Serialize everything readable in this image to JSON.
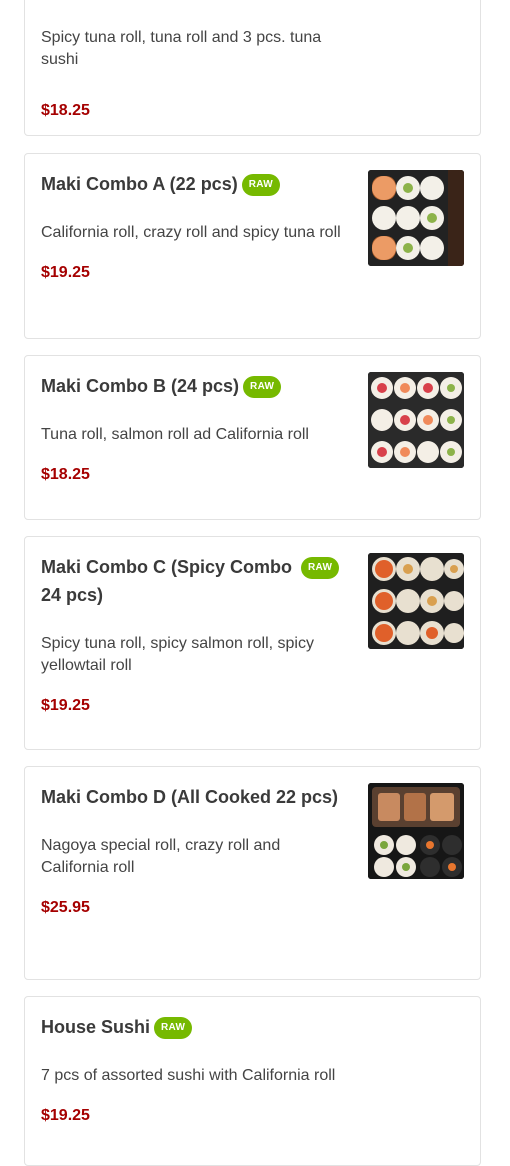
{
  "menu": {
    "items": [
      {
        "name": "",
        "raw": false,
        "description": "Spicy tuna roll, tuna roll and 3 pcs. tuna sushi",
        "price": "$18.25",
        "photo": "tuna-sushi-photo"
      },
      {
        "name": "Maki Combo A (22 pcs)",
        "raw": true,
        "raw_label": "RAW",
        "description": "California roll, crazy roll and spicy tuna roll",
        "price": "$19.25",
        "photo": "maki-combo-a-photo"
      },
      {
        "name": "Maki Combo B (24 pcs)",
        "raw": true,
        "raw_label": "RAW",
        "description": "Tuna roll, salmon roll ad California roll",
        "price": "$18.25",
        "photo": "maki-combo-b-photo"
      },
      {
        "name": "Maki Combo C (Spicy Combo 24 pcs)",
        "raw": true,
        "raw_label": "RAW",
        "description": "Spicy tuna roll, spicy salmon roll, spicy yellowtail roll",
        "price": "$19.25",
        "photo": "maki-combo-c-photo"
      },
      {
        "name": "Maki Combo D (All Cooked 22 pcs)",
        "raw": false,
        "description": "Nagoya special roll, crazy roll and California roll",
        "price": "$25.95",
        "photo": "maki-combo-d-photo"
      },
      {
        "name": "House Sushi",
        "raw": true,
        "raw_label": "RAW",
        "description": "7 pcs of assorted sushi with California roll",
        "price": "$19.25",
        "photo": null
      }
    ]
  },
  "colors": {
    "price": "#a50000",
    "raw_badge": "#76b900",
    "card_border": "#e2e2e2"
  }
}
